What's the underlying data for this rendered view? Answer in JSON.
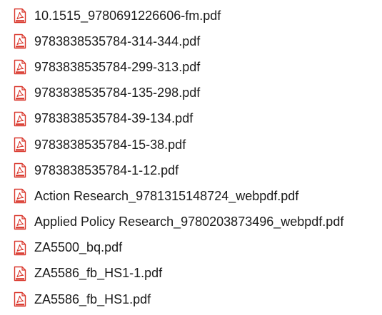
{
  "file_list": {
    "icon": "pdf-file-icon",
    "icon_color": "#d9362b",
    "items": [
      {
        "name": "10.1515_9780691226606-fm.pdf"
      },
      {
        "name": "9783838535784-314-344.pdf"
      },
      {
        "name": "9783838535784-299-313.pdf"
      },
      {
        "name": "9783838535784-135-298.pdf"
      },
      {
        "name": "9783838535784-39-134.pdf"
      },
      {
        "name": "9783838535784-15-38.pdf"
      },
      {
        "name": "9783838535784-1-12.pdf"
      },
      {
        "name": "Action Research_9781315148724_webpdf.pdf"
      },
      {
        "name": "Applied Policy Research_9780203873496_webpdf.pdf"
      },
      {
        "name": "ZA5500_bq.pdf"
      },
      {
        "name": "ZA5586_fb_HS1-1.pdf"
      },
      {
        "name": "ZA5586_fb_HS1.pdf"
      }
    ]
  }
}
